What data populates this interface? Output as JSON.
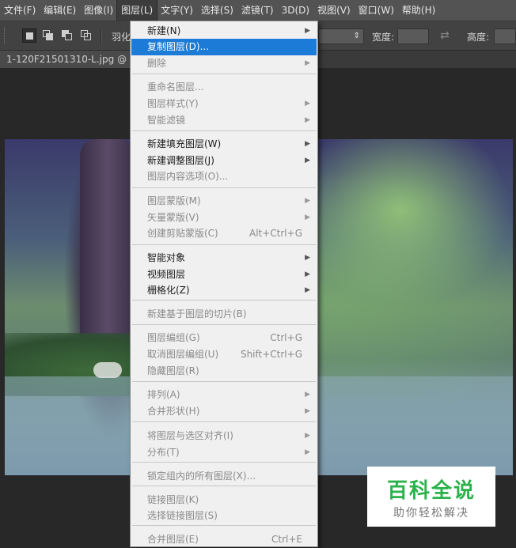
{
  "menubar": {
    "items": [
      "文件(F)",
      "编辑(E)",
      "图像(I)",
      "图层(L)",
      "文字(Y)",
      "选择(S)",
      "滤镜(T)",
      "3D(D)",
      "视图(V)",
      "窗口(W)",
      "帮助(H)"
    ]
  },
  "options": {
    "feather_label": "羽化",
    "width_label": "宽度:",
    "height_label": "高度:"
  },
  "document": {
    "tab_title": "1-120F21501310-L.jpg @ 1"
  },
  "layer_menu": {
    "items": [
      {
        "label": "新建(N)",
        "shortcut": "",
        "submenu": true,
        "enabled": true
      },
      {
        "label": "复制图层(D)...",
        "shortcut": "",
        "submenu": false,
        "enabled": true,
        "highlighted": true
      },
      {
        "label": "删除",
        "shortcut": "",
        "submenu": true,
        "enabled": false
      },
      {
        "label": "重命名图层...",
        "shortcut": "",
        "submenu": false,
        "enabled": false
      },
      {
        "label": "图层样式(Y)",
        "shortcut": "",
        "submenu": true,
        "enabled": false
      },
      {
        "label": "智能滤镜",
        "shortcut": "",
        "submenu": true,
        "enabled": false
      },
      {
        "label": "新建填充图层(W)",
        "shortcut": "",
        "submenu": true,
        "enabled": true
      },
      {
        "label": "新建调整图层(J)",
        "shortcut": "",
        "submenu": true,
        "enabled": true
      },
      {
        "label": "图层内容选项(O)...",
        "shortcut": "",
        "submenu": false,
        "enabled": false
      },
      {
        "label": "图层蒙版(M)",
        "shortcut": "",
        "submenu": true,
        "enabled": false
      },
      {
        "label": "矢量蒙版(V)",
        "shortcut": "",
        "submenu": true,
        "enabled": false
      },
      {
        "label": "创建剪贴蒙版(C)",
        "shortcut": "Alt+Ctrl+G",
        "submenu": false,
        "enabled": false
      },
      {
        "label": "智能对象",
        "shortcut": "",
        "submenu": true,
        "enabled": true
      },
      {
        "label": "视频图层",
        "shortcut": "",
        "submenu": true,
        "enabled": true
      },
      {
        "label": "栅格化(Z)",
        "shortcut": "",
        "submenu": true,
        "enabled": true
      },
      {
        "label": "新建基于图层的切片(B)",
        "shortcut": "",
        "submenu": false,
        "enabled": false
      },
      {
        "label": "图层编组(G)",
        "shortcut": "Ctrl+G",
        "submenu": false,
        "enabled": false
      },
      {
        "label": "取消图层编组(U)",
        "shortcut": "Shift+Ctrl+G",
        "submenu": false,
        "enabled": false
      },
      {
        "label": "隐藏图层(R)",
        "shortcut": "",
        "submenu": false,
        "enabled": false
      },
      {
        "label": "排列(A)",
        "shortcut": "",
        "submenu": true,
        "enabled": false
      },
      {
        "label": "合并形状(H)",
        "shortcut": "",
        "submenu": true,
        "enabled": false
      },
      {
        "label": "将图层与选区对齐(I)",
        "shortcut": "",
        "submenu": true,
        "enabled": false
      },
      {
        "label": "分布(T)",
        "shortcut": "",
        "submenu": true,
        "enabled": false
      },
      {
        "label": "锁定组内的所有图层(X)...",
        "shortcut": "",
        "submenu": false,
        "enabled": false
      },
      {
        "label": "链接图层(K)",
        "shortcut": "",
        "submenu": false,
        "enabled": false
      },
      {
        "label": "选择链接图层(S)",
        "shortcut": "",
        "submenu": false,
        "enabled": false
      },
      {
        "label": "合并图层(E)",
        "shortcut": "Ctrl+E",
        "submenu": false,
        "enabled": false
      }
    ]
  },
  "watermark": {
    "title": "百科全说",
    "subtitle": "助你轻松解决"
  }
}
